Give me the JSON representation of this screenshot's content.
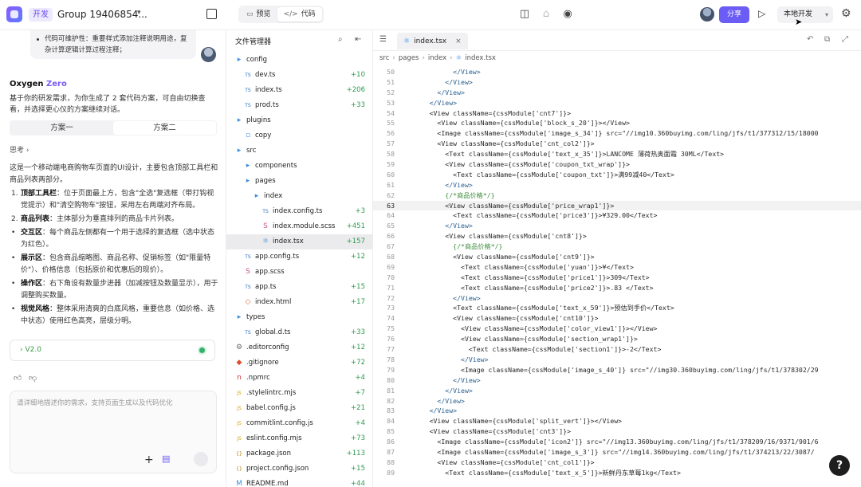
{
  "topbar": {
    "dev_badge": "开发",
    "project_title": "Group 19406854...",
    "mode_tabs": [
      {
        "label": "预览",
        "active": false
      },
      {
        "label": "代码",
        "active": true
      }
    ],
    "share_label": "分享",
    "env_label": "本地开发"
  },
  "chat": {
    "prev_message": "代码可维护性：重要样式添加注释说明用途，复杂计算逻辑计算过程注释；",
    "agent_name": "Oxygen",
    "agent_name_accent": "Zero",
    "intro": "基于你的研发需求，为你生成了 2 套代码方案，可自由切换查看，并选择更心仪的方案继续对话。",
    "plan_tabs": [
      "方案一",
      "方案二"
    ],
    "think_label": "思考",
    "body": "这是一个移动端电商购物车页面的UI设计，主要包含顶部工具栏和商品列表两部分。",
    "features": [
      {
        "mark": "1.",
        "title": "顶部工具栏",
        "text": "：位于页面最上方，包含\"全选\"复选框（带打钩视觉提示）和\"清空购物车\"按钮，采用左右两端对齐布局。"
      },
      {
        "mark": "2.",
        "title": "商品列表",
        "text": "：主体部分为垂直排列的商品卡片列表。"
      },
      {
        "mark": "•",
        "title": "交互区",
        "text": "：每个商品左侧都有一个用于选择的复选框（选中状态为红色）。"
      },
      {
        "mark": "•",
        "title": "展示区",
        "text": "：包含商品缩略图、商品名称、促销标签（如\"限量特价\"）、价格信息（包括原价和优惠后的现价）。"
      },
      {
        "mark": "•",
        "title": "操作区",
        "text": "：右下角设有数量步进器（加减按钮及数量显示），用于调整购买数量。"
      },
      {
        "mark": "•",
        "title": "视觉风格",
        "text": "：整体采用清爽的白底风格，重要信息（如价格、选中状态）使用红色高亮，层级分明。"
      }
    ],
    "version": "V2.0",
    "input_placeholder": "请详细地描述你的需求，支持页面生成以及代码优化"
  },
  "explorer": {
    "title": "文件管理器",
    "items": [
      {
        "name": "config",
        "type": "folder",
        "depth": 0,
        "status": ""
      },
      {
        "name": "dev.ts",
        "type": "ts",
        "depth": 1,
        "status": "+10"
      },
      {
        "name": "index.ts",
        "type": "ts",
        "depth": 1,
        "status": "+206"
      },
      {
        "name": "prod.ts",
        "type": "ts",
        "depth": 1,
        "status": "+33"
      },
      {
        "name": "plugins",
        "type": "folder",
        "depth": 0,
        "status": ""
      },
      {
        "name": "copy",
        "type": "file",
        "depth": 1,
        "status": ""
      },
      {
        "name": "src",
        "type": "folder",
        "depth": 0,
        "status": ""
      },
      {
        "name": "components",
        "type": "folder",
        "depth": 1,
        "status": ""
      },
      {
        "name": "pages",
        "type": "folder",
        "depth": 1,
        "status": ""
      },
      {
        "name": "index",
        "type": "folder",
        "depth": 2,
        "status": ""
      },
      {
        "name": "index.config.ts",
        "type": "ts",
        "depth": 3,
        "status": "+3"
      },
      {
        "name": "index.module.scss",
        "type": "scss",
        "depth": 3,
        "status": "+451"
      },
      {
        "name": "index.tsx",
        "type": "tsx",
        "depth": 3,
        "status": "+157",
        "selected": true
      },
      {
        "name": "app.config.ts",
        "type": "ts",
        "depth": 1,
        "status": "+12"
      },
      {
        "name": "app.scss",
        "type": "scss",
        "depth": 1,
        "status": ""
      },
      {
        "name": "app.ts",
        "type": "ts",
        "depth": 1,
        "status": "+15"
      },
      {
        "name": "index.html",
        "type": "html",
        "depth": 1,
        "status": "+17"
      },
      {
        "name": "types",
        "type": "folder",
        "depth": 0,
        "status": ""
      },
      {
        "name": "global.d.ts",
        "type": "ts",
        "depth": 1,
        "status": "+33"
      },
      {
        "name": ".editorconfig",
        "type": "cfg",
        "depth": 0,
        "status": "+12"
      },
      {
        "name": ".gitignore",
        "type": "git",
        "depth": 0,
        "status": "+72"
      },
      {
        "name": ".npmrc",
        "type": "npm",
        "depth": 0,
        "status": "+4"
      },
      {
        "name": ".stylelintrc.mjs",
        "type": "js",
        "depth": 0,
        "status": "+7"
      },
      {
        "name": "babel.config.js",
        "type": "js",
        "depth": 0,
        "status": "+21"
      },
      {
        "name": "commitlint.config.js",
        "type": "js",
        "depth": 0,
        "status": "+4"
      },
      {
        "name": "eslint.config.mjs",
        "type": "js",
        "depth": 0,
        "status": "+73"
      },
      {
        "name": "package.json",
        "type": "json",
        "depth": 0,
        "status": "+113"
      },
      {
        "name": "project.config.json",
        "type": "json",
        "depth": 0,
        "status": "+15"
      },
      {
        "name": "README.md",
        "type": "md",
        "depth": 0,
        "status": "+44"
      }
    ]
  },
  "editor": {
    "tab_name": "index.tsx",
    "breadcrumb": [
      "src",
      "pages",
      "index",
      "index.tsx"
    ],
    "current_line": 63,
    "lines": [
      {
        "n": 50,
        "t": "            </View>"
      },
      {
        "n": 51,
        "t": "          </View>"
      },
      {
        "n": 52,
        "t": "        </View>"
      },
      {
        "n": 53,
        "t": "      </View>"
      },
      {
        "n": 54,
        "t": "      <View className={cssModule['cnt7']}>"
      },
      {
        "n": 55,
        "t": "        <View className={cssModule['block_s_20']}></View>"
      },
      {
        "n": 56,
        "t": "        <Image className={cssModule['image_s_34']} src=\"//img10.360buyimg.com/ling/jfs/t1/377312/15/18000"
      },
      {
        "n": 57,
        "t": "        <View className={cssModule['cnt_col2']}>"
      },
      {
        "n": 58,
        "t": "          <Text className={cssModule['text_x_35']}>LANCOME 薄荷热奥面霜 30ML</Text>"
      },
      {
        "n": 59,
        "t": "          <View className={cssModule['coupon_txt_wrap']}>"
      },
      {
        "n": 60,
        "t": "            <Text className={cssModule['coupon_txt']}>满99减40</Text>"
      },
      {
        "n": 61,
        "t": "          </View>"
      },
      {
        "n": 62,
        "t": "          {/*商品价格*/}"
      },
      {
        "n": 63,
        "t": "          <View className={cssModule['price_wrap1']}>"
      },
      {
        "n": 64,
        "t": "            <Text className={cssModule['price3']}>¥329.00</Text>"
      },
      {
        "n": 65,
        "t": "          </View>"
      },
      {
        "n": 66,
        "t": "          <View className={cssModule['cnt8']}>"
      },
      {
        "n": 67,
        "t": "            {/*商品价格*/}"
      },
      {
        "n": 68,
        "t": "            <View className={cssModule['cnt9']}>"
      },
      {
        "n": 69,
        "t": "              <Text className={cssModule['yuan']}>¥</Text>"
      },
      {
        "n": 70,
        "t": "              <Text className={cssModule['price1']}>309</Text>"
      },
      {
        "n": 71,
        "t": "              <Text className={cssModule['price2']}>.83 </Text>"
      },
      {
        "n": 72,
        "t": "            </View>"
      },
      {
        "n": 73,
        "t": "            <Text className={cssModule['text_x_59']}>预估到手价</Text>"
      },
      {
        "n": 74,
        "t": "            <View className={cssModule['cnt10']}>"
      },
      {
        "n": 75,
        "t": "              <View className={cssModule['color_view1']}></View>"
      },
      {
        "n": 76,
        "t": "              <View className={cssModule['section_wrap1']}>"
      },
      {
        "n": 77,
        "t": "                <Text className={cssModule['section1']}>-2</Text>"
      },
      {
        "n": 78,
        "t": "              </View>"
      },
      {
        "n": 79,
        "t": "              <Image className={cssModule['image_s_40']} src=\"//img30.360buyimg.com/ling/jfs/t1/378302/29"
      },
      {
        "n": 80,
        "t": "            </View>"
      },
      {
        "n": 81,
        "t": "          </View>"
      },
      {
        "n": 82,
        "t": "        </View>"
      },
      {
        "n": 83,
        "t": "      </View>"
      },
      {
        "n": 84,
        "t": "      <View className={cssModule['split_vert']}></View>"
      },
      {
        "n": 85,
        "t": "      <View className={cssModule['cnt3']}>"
      },
      {
        "n": 86,
        "t": "        <Image className={cssModule['icon2']} src=\"//img13.360buyimg.com/ling/jfs/t1/378209/16/9371/901/6"
      },
      {
        "n": 87,
        "t": "        <Image className={cssModule['image_s_3']} src=\"//img14.360buyimg.com/ling/jfs/t1/374213/22/3087/"
      },
      {
        "n": 88,
        "t": "        <View className={cssModule['cnt_col1']}>"
      },
      {
        "n": 89,
        "t": "          <Text className={cssModule['text_x_5']}>新鲜丹东草莓1kg</Text>"
      }
    ]
  },
  "colors": {
    "accent": "#6b5cf5",
    "added": "#2d9a4f",
    "modified": "#c9931b",
    "version_ok": "#2fb36a"
  }
}
